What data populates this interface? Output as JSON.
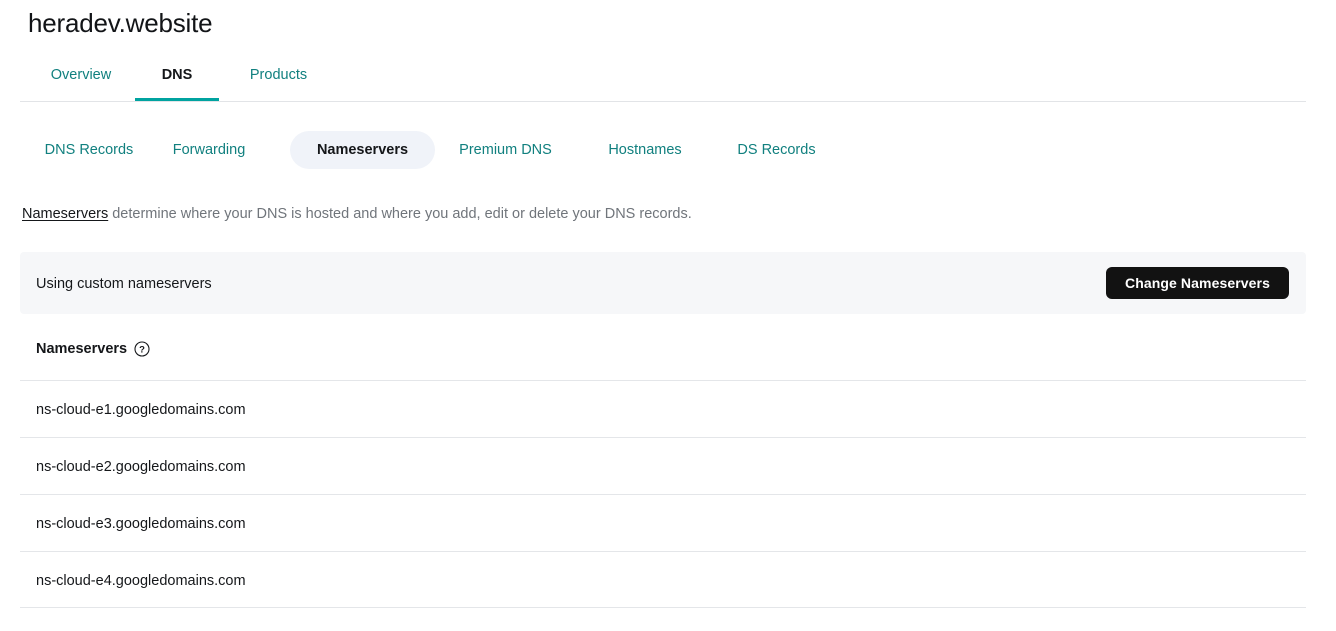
{
  "page_title": "heradev.website",
  "primary_tabs": [
    {
      "label": "Overview",
      "active": false
    },
    {
      "label": "DNS",
      "active": true
    },
    {
      "label": "Products",
      "active": false
    }
  ],
  "sub_tabs": [
    {
      "label": "DNS Records",
      "active": false
    },
    {
      "label": "Forwarding",
      "active": false
    },
    {
      "label": "Nameservers",
      "active": true
    },
    {
      "label": "Premium DNS",
      "active": false
    },
    {
      "label": "Hostnames",
      "active": false
    },
    {
      "label": "DS Records",
      "active": false
    }
  ],
  "description": {
    "link_text": "Nameservers",
    "rest_text": " determine where your DNS is hosted and where you add, edit or delete your DNS records."
  },
  "status_banner": {
    "text": "Using custom nameservers",
    "button_label": "Change Nameservers"
  },
  "nameservers_section": {
    "header": "Nameservers",
    "help_icon": "question-circle-icon",
    "rows": [
      {
        "value": "ns-cloud-e1.googledomains.com"
      },
      {
        "value": "ns-cloud-e2.googledomains.com"
      },
      {
        "value": "ns-cloud-e3.googledomains.com"
      },
      {
        "value": "ns-cloud-e4.googledomains.com"
      }
    ]
  },
  "colors": {
    "accent_teal": "#00a3a0",
    "link_teal": "#11807f",
    "button_dark": "#121212",
    "banner_bg": "#f6f7f9",
    "pill_bg": "#f0f3f9",
    "muted_text": "#70757b",
    "divider": "#e4e6e9"
  }
}
